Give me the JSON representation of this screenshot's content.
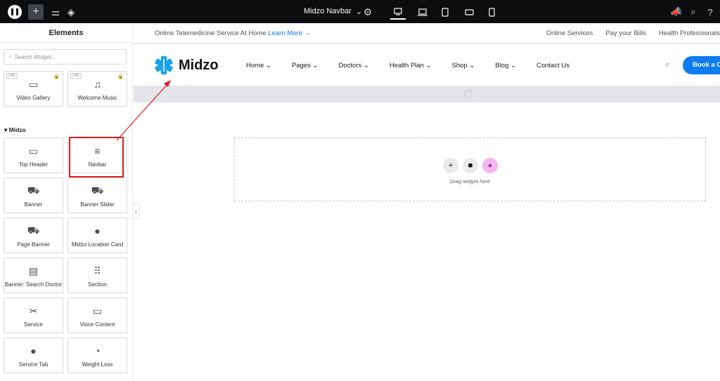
{
  "topbar": {
    "document_title": "Midzo Navbar",
    "chevron": "⌄"
  },
  "panel": {
    "title": "Elements",
    "search_placeholder": "Search Widget...",
    "category": "Midzo",
    "badge": "UAE",
    "widgets_top": [
      {
        "label": "Video Gallery",
        "icon": "video-gallery-icon",
        "glyph": "▭"
      },
      {
        "label": "Welcome Music",
        "icon": "music-icon",
        "glyph": "♫"
      }
    ],
    "widgets": [
      {
        "label": "Top Header",
        "icon": "window-icon",
        "glyph": "▭"
      },
      {
        "label": "Navbar",
        "icon": "hamburger-icon",
        "glyph": "≡"
      },
      {
        "label": "Banner",
        "icon": "car-icon",
        "glyph": "⛟"
      },
      {
        "label": "Banner Slider",
        "icon": "car-icon",
        "glyph": "⛟"
      },
      {
        "label": "Page Banner",
        "icon": "car-icon",
        "glyph": "⛟"
      },
      {
        "label": "Midzo Location Card",
        "icon": "location-pin-icon",
        "glyph": "●"
      },
      {
        "label": "Banner: Search Doctor",
        "icon": "form-icon",
        "glyph": "▤"
      },
      {
        "label": "Section",
        "icon": "grid-dots-icon",
        "glyph": "⠿"
      },
      {
        "label": "Service",
        "icon": "tools-icon",
        "glyph": "✂"
      },
      {
        "label": "Voice Content",
        "icon": "voice-icon",
        "glyph": "▭"
      },
      {
        "label": "Service Tab",
        "icon": "location-pin-icon",
        "glyph": "●"
      },
      {
        "label": "Weight Loss",
        "icon": "gauge-icon",
        "glyph": "◔"
      }
    ]
  },
  "site": {
    "notice_text": "Online Telemedicine Service At Home",
    "notice_link": "Learn More →",
    "top_links": [
      "Online Services",
      "Pay your Bills",
      "Health Professionals"
    ],
    "brand": "Midzo",
    "menu": [
      "Home ⌄",
      "Pages ⌄",
      "Doctors ⌄",
      "Health Plan ⌄",
      "Shop ⌄",
      "Blog ⌄",
      "Contact Us"
    ],
    "cta": "Book a C",
    "drop_text": "Drag widget here"
  },
  "colors": {
    "accent": "#0d7bf2",
    "highlight": "#e01b1b",
    "ai": "#f3b5f0"
  }
}
